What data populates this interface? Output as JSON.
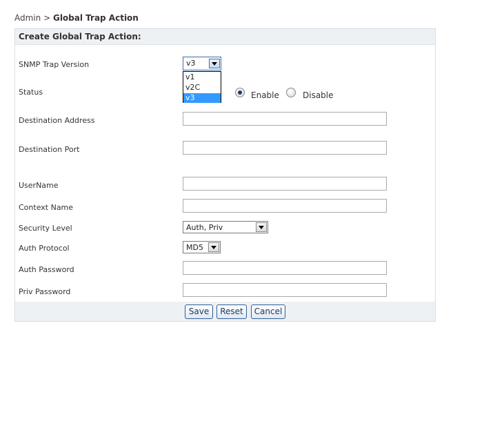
{
  "breadcrumb": {
    "root": "Admin",
    "separator": ">",
    "current": "Global Trap Action"
  },
  "panel": {
    "title": "Create Global Trap Action:"
  },
  "form": {
    "snmp_version": {
      "label": "SNMP Trap Version",
      "value": "v3",
      "options": [
        "v1",
        "v2C",
        "v3"
      ],
      "selected_index": 2,
      "open": true
    },
    "status": {
      "label": "Status",
      "options": [
        {
          "label": "Enable",
          "checked": true
        },
        {
          "label": "Disable",
          "checked": false
        }
      ]
    },
    "destination_address": {
      "label": "Destination Address",
      "value": ""
    },
    "destination_port": {
      "label": "Destination Port",
      "value": ""
    },
    "username": {
      "label": "UserName",
      "value": ""
    },
    "context_name": {
      "label": "Context Name",
      "value": ""
    },
    "security_level": {
      "label": "Security Level",
      "value": "Auth, Priv"
    },
    "auth_protocol": {
      "label": "Auth Protocol",
      "value": "MD5"
    },
    "auth_password": {
      "label": "Auth Password",
      "value": ""
    },
    "priv_password": {
      "label": "Priv Password",
      "value": ""
    }
  },
  "buttons": {
    "save": "Save",
    "reset": "Reset",
    "cancel": "Cancel"
  },
  "colors": {
    "header_bg": "#eef1f4",
    "selection": "#3399ff",
    "button_border": "#2f5f9a"
  }
}
